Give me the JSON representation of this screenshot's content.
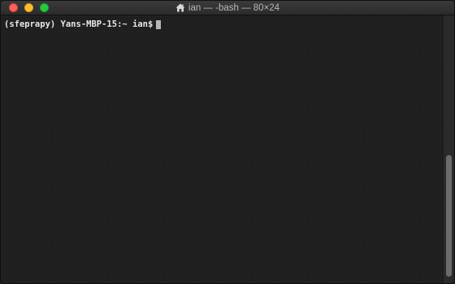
{
  "window": {
    "title": "ian — -bash — 80×24",
    "title_icon": "home-icon",
    "traffic_lights": {
      "close": "#ff5f57",
      "minimize": "#ffbd2e",
      "zoom": "#28c940"
    }
  },
  "terminal": {
    "prompt": "(sfeprapy) Yans-MBP-15:~ ian$",
    "background": "#1e1e1e",
    "text_color": "#e8e8e8",
    "cursor_shape": "block"
  }
}
